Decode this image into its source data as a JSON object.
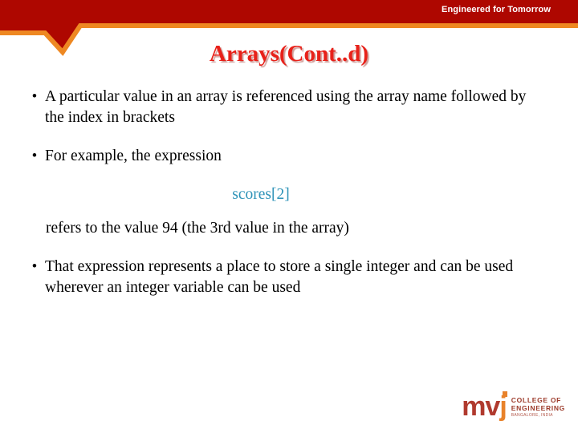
{
  "slide": {
    "title": "Arrays(Cont..d)",
    "tagline": "Engineered for Tomorrow"
  },
  "colors": {
    "header_red": "#AE0700",
    "accent_orange": "#EE8822",
    "title_red": "#E8211A",
    "code_blue": "#2E93B8",
    "logo_maroon": "#B03A2E",
    "logo_orange": "#E8822A",
    "body_black": "#000000"
  },
  "body": {
    "bullet_char": "•",
    "blocks": [
      {
        "kind": "bullet",
        "text": "A particular value in an array is referenced using the array name followed by the index in brackets"
      },
      {
        "kind": "bullet",
        "text": "For example, the expression"
      },
      {
        "kind": "code",
        "text": "scores[2]"
      },
      {
        "kind": "plain",
        "text": "refers to the value 94 (the 3rd value in the array)"
      },
      {
        "kind": "bullet",
        "text": "That expression represents a place to store a single integer and can be used wherever an integer variable can be used"
      }
    ]
  },
  "logo": {
    "mark_mv": "mv",
    "mark_j": "j",
    "line1": "COLLEGE OF",
    "line2": "ENGINEERING",
    "line3": "BANGALORE, INDIA"
  }
}
